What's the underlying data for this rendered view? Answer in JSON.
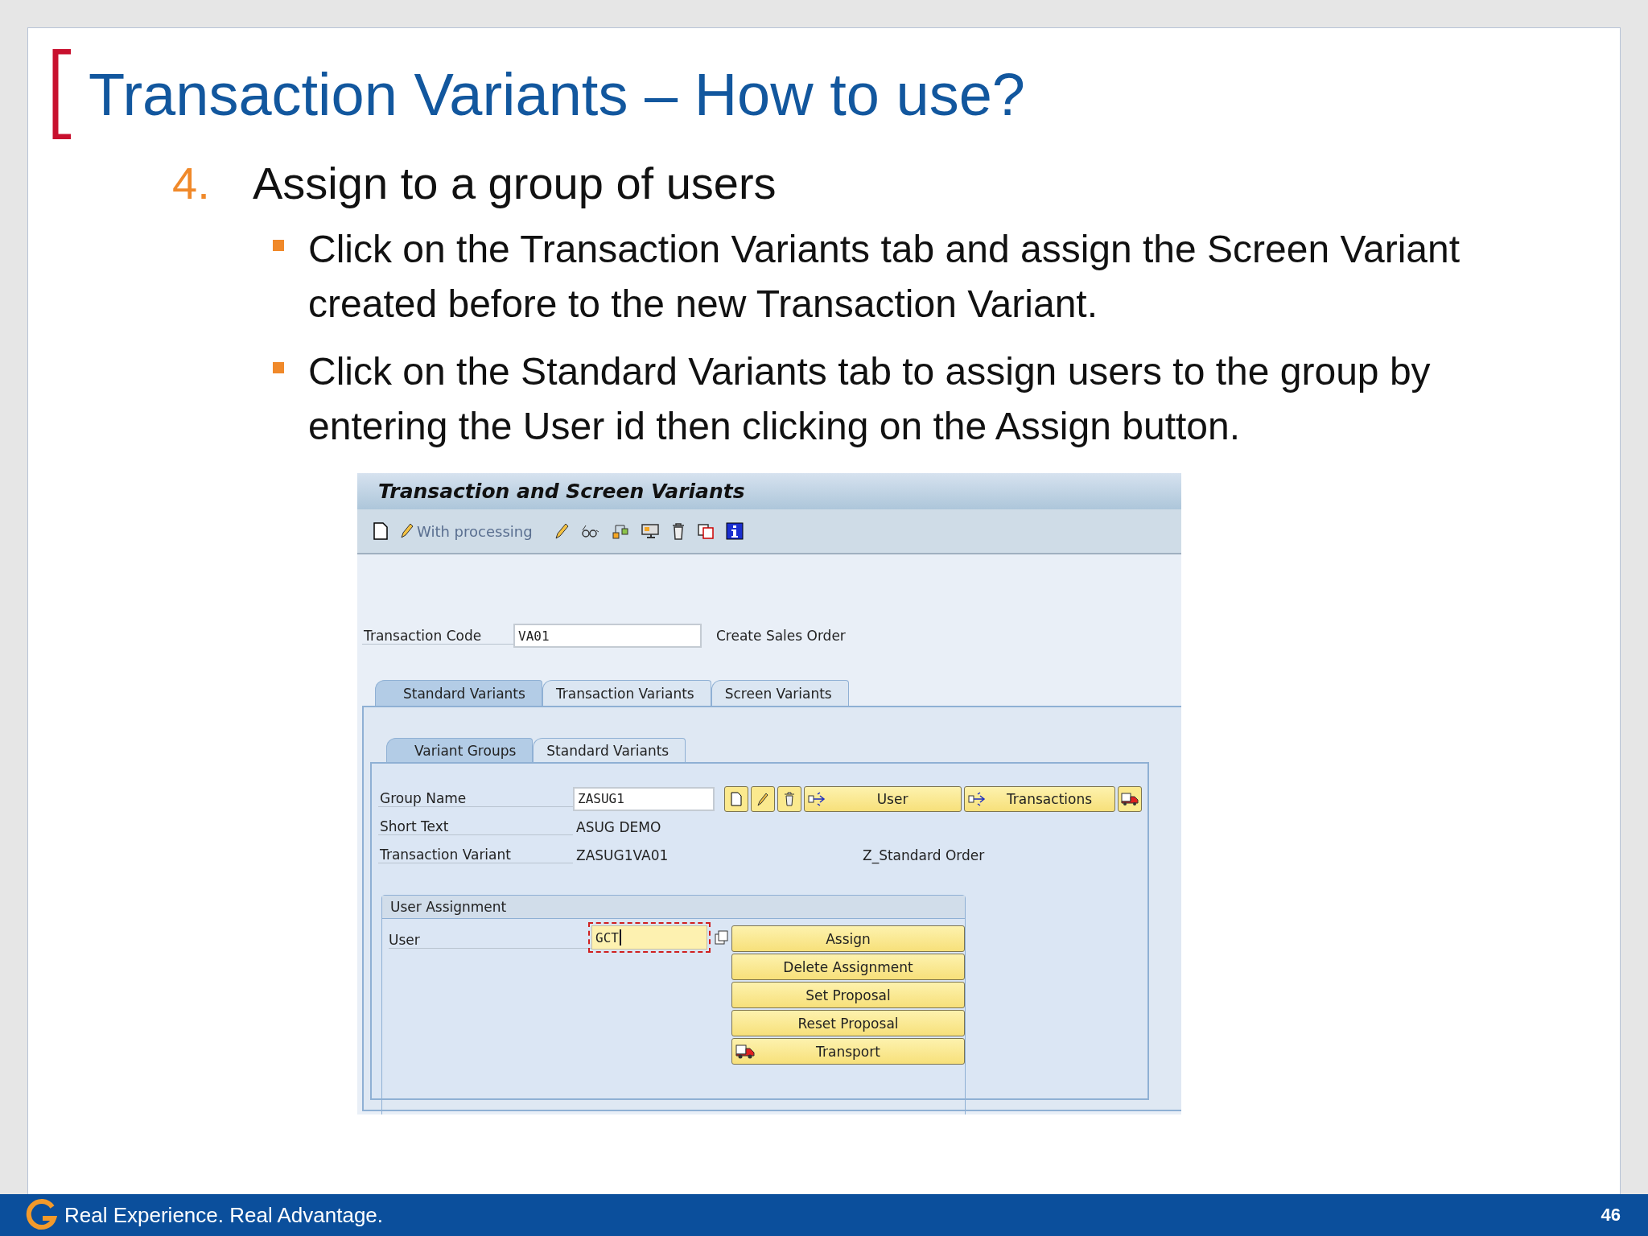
{
  "slide": {
    "title": "Transaction Variants – How to use?",
    "step": {
      "number": "4.",
      "text": "Assign to a group of users"
    },
    "bullets": [
      "Click on the Transaction Variants tab and assign the Screen Variant created before to the new Transaction Variant.",
      "Click on the Standard Variants tab to assign users to the group by entering the User id then clicking on the Assign button."
    ]
  },
  "sap_window": {
    "title": "Transaction and Screen Variants",
    "toolbar": {
      "button_label": "With processing"
    },
    "transaction_code": {
      "label": "Transaction Code",
      "value": "VA01",
      "description": "Create Sales Order"
    },
    "tabs": [
      {
        "label": "Standard Variants",
        "selected": true
      },
      {
        "label": "Transaction Variants",
        "selected": false
      },
      {
        "label": "Screen Variants",
        "selected": false
      }
    ],
    "subtabs": [
      {
        "label": "Variant Groups",
        "selected": true
      },
      {
        "label": "Standard Variants",
        "selected": false
      }
    ],
    "fields": [
      {
        "kind": "input",
        "label": "Group Name",
        "value": "ZASUG1"
      },
      {
        "kind": "text",
        "label": "Short Text",
        "value": "ASUG DEMO"
      },
      {
        "kind": "text",
        "label": "Transaction Variant",
        "value": "ZASUG1VA01",
        "description": "Z_Standard Order"
      }
    ],
    "group_buttons": [
      {
        "label": "User"
      },
      {
        "label": "Transactions"
      }
    ],
    "user_assignment": {
      "title": "User Assignment",
      "user_label": "User",
      "user_value": "GCT",
      "focused": true,
      "buttons": [
        {
          "kind": "plain",
          "label": "Assign"
        },
        {
          "kind": "plain",
          "label": "Delete Assignment"
        },
        {
          "kind": "plain",
          "label": "Set Proposal"
        },
        {
          "kind": "plain",
          "label": "Reset Proposal"
        },
        {
          "kind": "truck",
          "label": "Transport"
        }
      ]
    }
  },
  "footer": {
    "tagline": "Real Experience. Real Advantage.",
    "page_number": "46"
  }
}
